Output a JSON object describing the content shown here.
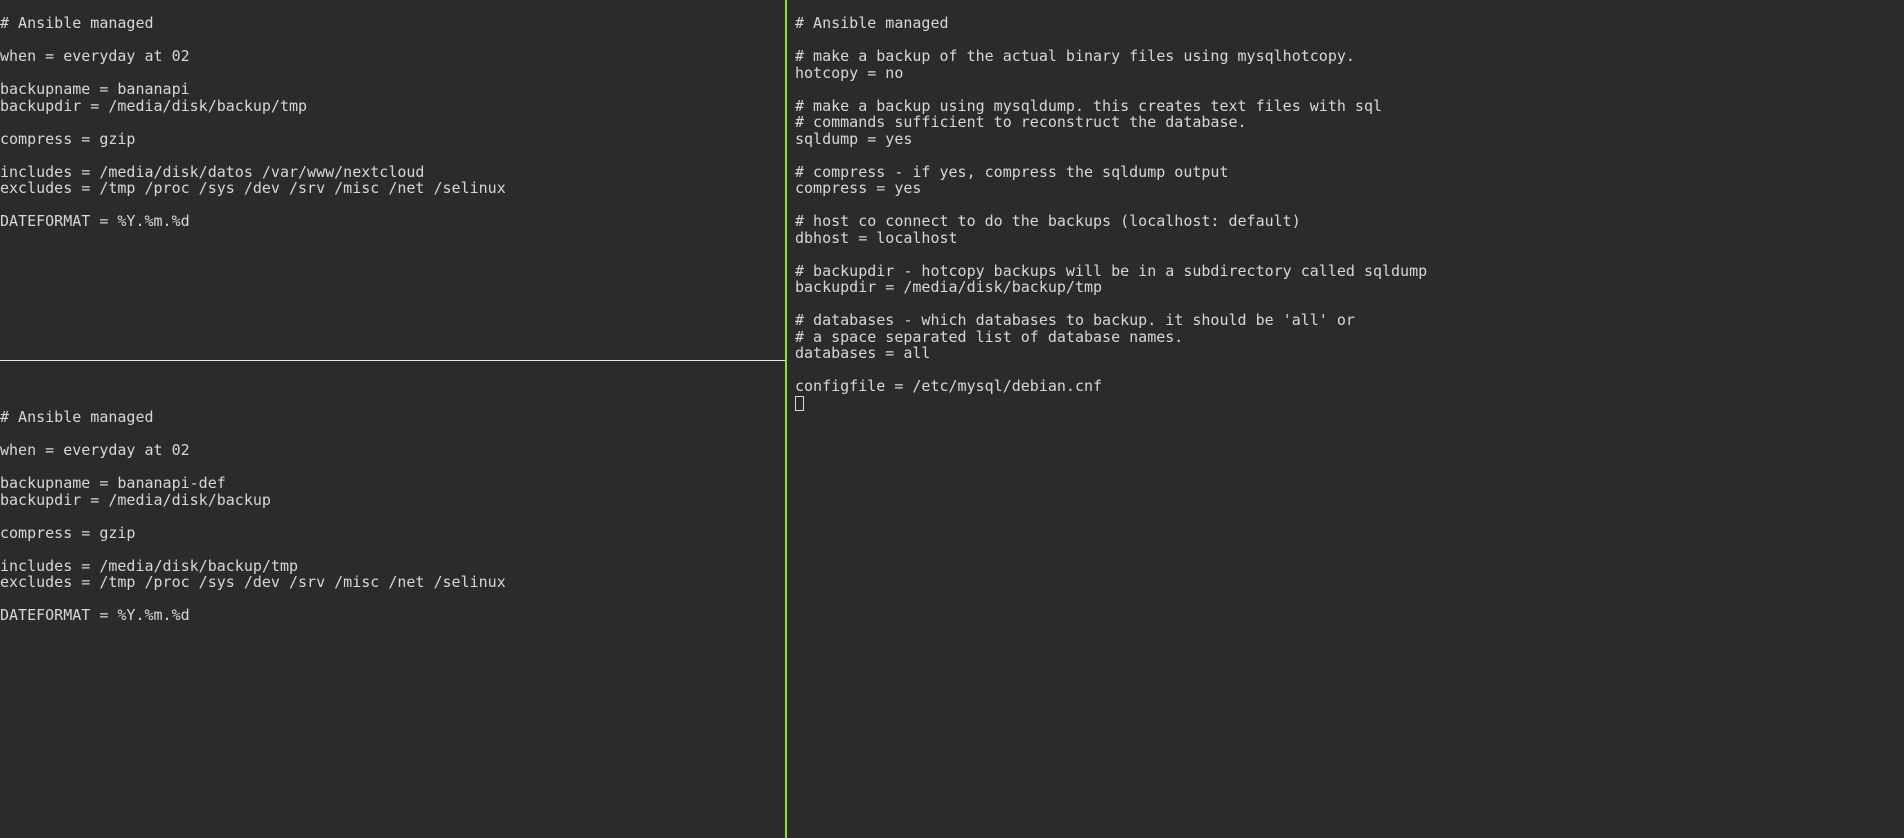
{
  "left_top": {
    "lines": [
      "# Ansible managed",
      "",
      "when = everyday at 02",
      "",
      "backupname = bananapi",
      "backupdir = /media/disk/backup/tmp",
      "",
      "compress = gzip",
      "",
      "includes = /media/disk/datos /var/www/nextcloud",
      "excludes = /tmp /proc /sys /dev /srv /misc /net /selinux",
      "",
      "DATEFORMAT = %Y.%m.%d"
    ]
  },
  "left_bot": {
    "lines": [
      "# Ansible managed",
      "",
      "when = everyday at 02",
      "",
      "backupname = bananapi-def",
      "backupdir = /media/disk/backup",
      "",
      "compress = gzip",
      "",
      "includes = /media/disk/backup/tmp",
      "excludes = /tmp /proc /sys /dev /srv /misc /net /selinux",
      "",
      "DATEFORMAT = %Y.%m.%d"
    ]
  },
  "right": {
    "lines": [
      "# Ansible managed",
      "",
      "# make a backup of the actual binary files using mysqlhotcopy.",
      "hotcopy = no",
      "",
      "# make a backup using mysqldump. this creates text files with sql",
      "# commands sufficient to reconstruct the database.",
      "sqldump = yes",
      "",
      "# compress - if yes, compress the sqldump output",
      "compress = yes",
      "",
      "# host co connect to do the backups (localhost: default)",
      "dbhost = localhost",
      "",
      "# backupdir - hotcopy backups will be in a subdirectory called sqldump",
      "backupdir = /media/disk/backup/tmp",
      "",
      "# databases - which databases to backup. it should be 'all' or",
      "# a space separated list of database names.",
      "databases = all",
      "",
      "configfile = /etc/mysql/debian.cnf"
    ]
  }
}
